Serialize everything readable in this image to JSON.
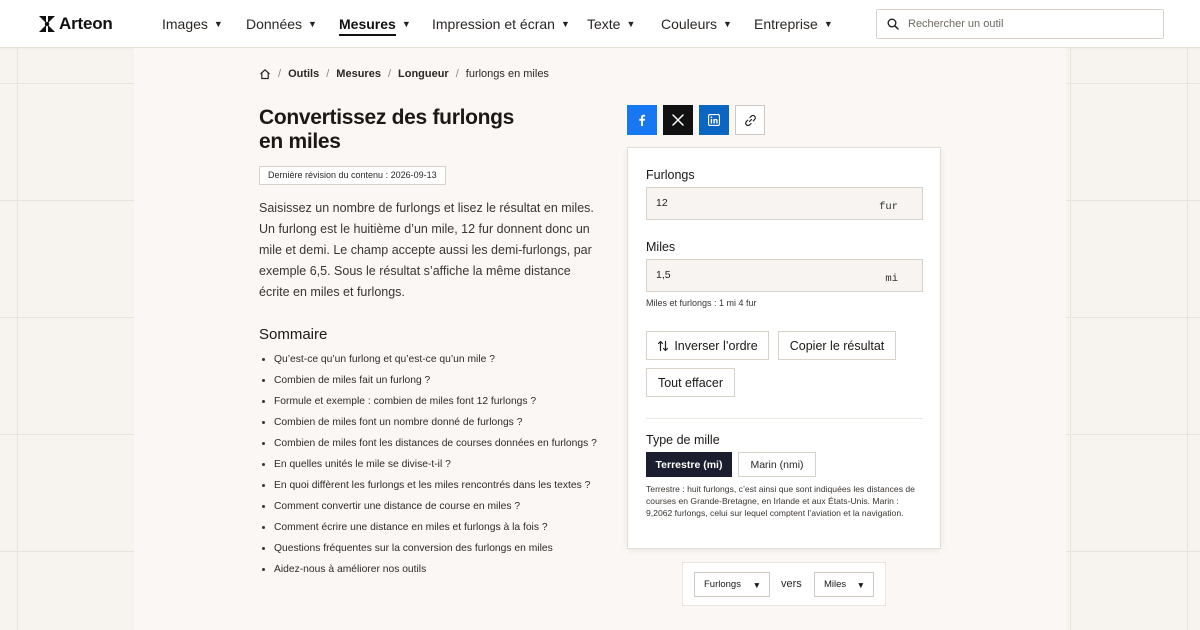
{
  "header": {
    "logo_text": "Arteon",
    "nav": [
      {
        "label": "Images",
        "active": false
      },
      {
        "label": "Données",
        "active": false
      },
      {
        "label": "Mesures",
        "active": true
      },
      {
        "label": "Impression et écran",
        "active": false
      },
      {
        "label": "Texte",
        "active": false
      },
      {
        "label": "Couleurs",
        "active": false
      },
      {
        "label": "Entreprise",
        "active": false
      }
    ],
    "search_placeholder": "Rechercher un outil"
  },
  "breadcrumb": {
    "items": [
      "Outils",
      "Mesures",
      "Longueur"
    ],
    "current": "furlongs en miles"
  },
  "page": {
    "title": "Convertissez des furlongs en miles",
    "revision": "Dernière révision du contenu : 2026-09-13",
    "intro": "Saisissez un nombre de furlongs et lisez le résultat en miles. Un furlong est le huitième d’un mile, 12 fur donnent donc un mile et demi. Le champ accepte aussi les demi-furlongs, par exemple 6,5. Sous le résultat s’affiche la même distance écrite en miles et furlongs.",
    "summary_title": "Sommaire",
    "summary_items": [
      "Qu’est-ce qu’un furlong et qu’est-ce qu’un mile ?",
      "Combien de miles fait un furlong ?",
      "Formule et exemple : combien de miles font 12 furlongs ?",
      "Combien de miles font un nombre donné de furlongs ?",
      "Combien de miles font les distances de courses données en furlongs ?",
      "En quelles unités le mile se divise-t-il ?",
      "En quoi diffèrent les furlongs et les miles rencontrés dans les textes ?",
      "Comment convertir une distance de course en miles ?",
      "Comment écrire une distance en miles et furlongs à la fois ?",
      "Questions fréquentes sur la conversion des furlongs en miles",
      "Aidez-nous à améliorer nos outils"
    ]
  },
  "share": {
    "icons": [
      "facebook-icon",
      "x-icon",
      "linkedin-icon",
      "link-icon"
    ],
    "colors": {
      "facebook": "#1877f2",
      "x": "#111111",
      "linkedin": "#0a66c2"
    }
  },
  "converter": {
    "from_label": "Furlongs",
    "from_value": "12",
    "from_unit": "fur",
    "to_label": "Miles",
    "to_value": "1,5",
    "to_unit": "mi",
    "mixed_note": "Miles et furlongs : 1 mi 4 fur",
    "swap_label": "Inverser l’ordre",
    "copy_label": "Copier le résultat",
    "clear_label": "Tout effacer",
    "mile_type_label": "Type de mille",
    "mile_type_options": [
      "Terrestre (mi)",
      "Marin (nmi)"
    ],
    "mile_type_selected": "Terrestre (mi)",
    "mile_type_description": "Terrestre : huit furlongs, c’est ainsi que sont indiquées les distances de courses en Grande-Bretagne, en Irlande et aux États-Unis. Marin : 9,2062 furlongs, celui sur lequel comptent l’aviation et la navigation."
  },
  "unit_picker": {
    "from": "Furlongs",
    "connector": "vers",
    "to": "Miles"
  },
  "colors": {
    "accent_dark": "#1a1e2e",
    "background": "#f7f3ef"
  }
}
